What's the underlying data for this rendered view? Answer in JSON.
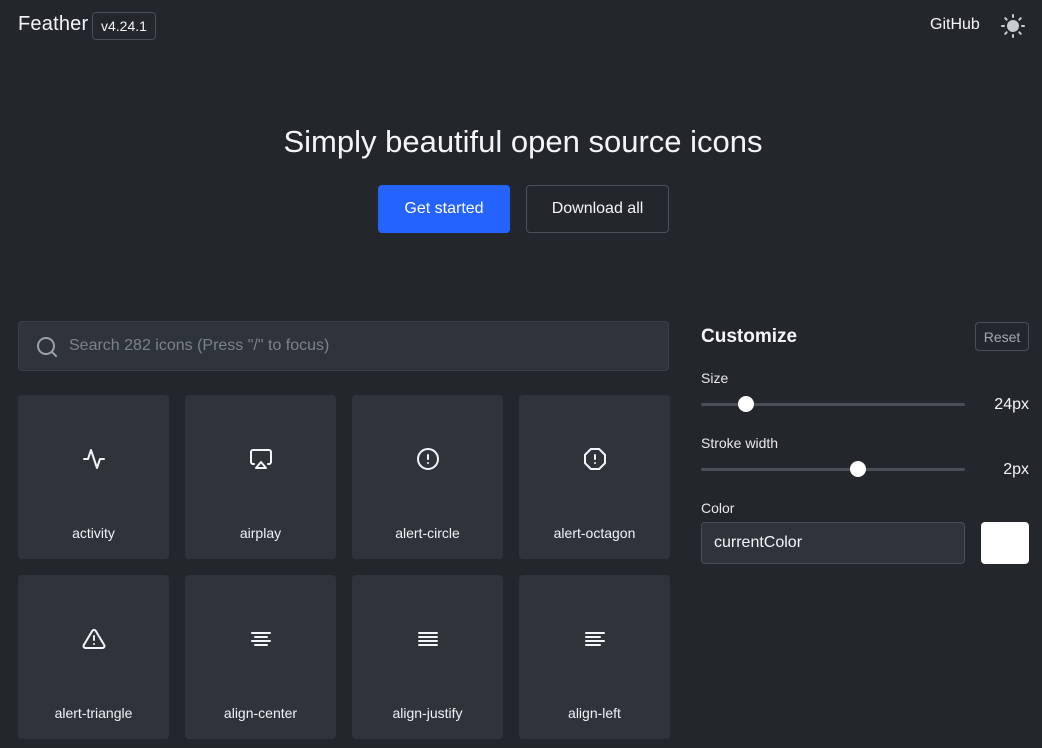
{
  "header": {
    "brand": "Feather",
    "version": "v4.24.1",
    "github_label": "GitHub",
    "theme_icon": "sun-icon"
  },
  "hero": {
    "title": "Simply beautiful open source icons",
    "primary_button": "Get started",
    "secondary_button": "Download all"
  },
  "search": {
    "placeholder": "Search 282 icons (Press \"/\" to focus)",
    "value": ""
  },
  "icons": [
    {
      "name": "activity",
      "icon": "activity-icon"
    },
    {
      "name": "airplay",
      "icon": "airplay-icon"
    },
    {
      "name": "alert-circle",
      "icon": "alert-circle-icon"
    },
    {
      "name": "alert-octagon",
      "icon": "alert-octagon-icon"
    },
    {
      "name": "alert-triangle",
      "icon": "alert-triangle-icon"
    },
    {
      "name": "align-center",
      "icon": "align-center-icon"
    },
    {
      "name": "align-justify",
      "icon": "align-justify-icon"
    },
    {
      "name": "align-left",
      "icon": "align-left-icon"
    }
  ],
  "customize": {
    "title": "Customize",
    "reset_label": "Reset",
    "size": {
      "label": "Size",
      "value": "24px",
      "fraction": 0.15
    },
    "stroke": {
      "label": "Stroke width",
      "value": "2px",
      "fraction": 0.6
    },
    "color": {
      "label": "Color",
      "value": "currentColor",
      "swatch": "#ffffff"
    }
  },
  "colors": {
    "background": "#23262b",
    "card": "#2f333a",
    "accent": "#2563ff",
    "text": "#f4f5f7"
  }
}
